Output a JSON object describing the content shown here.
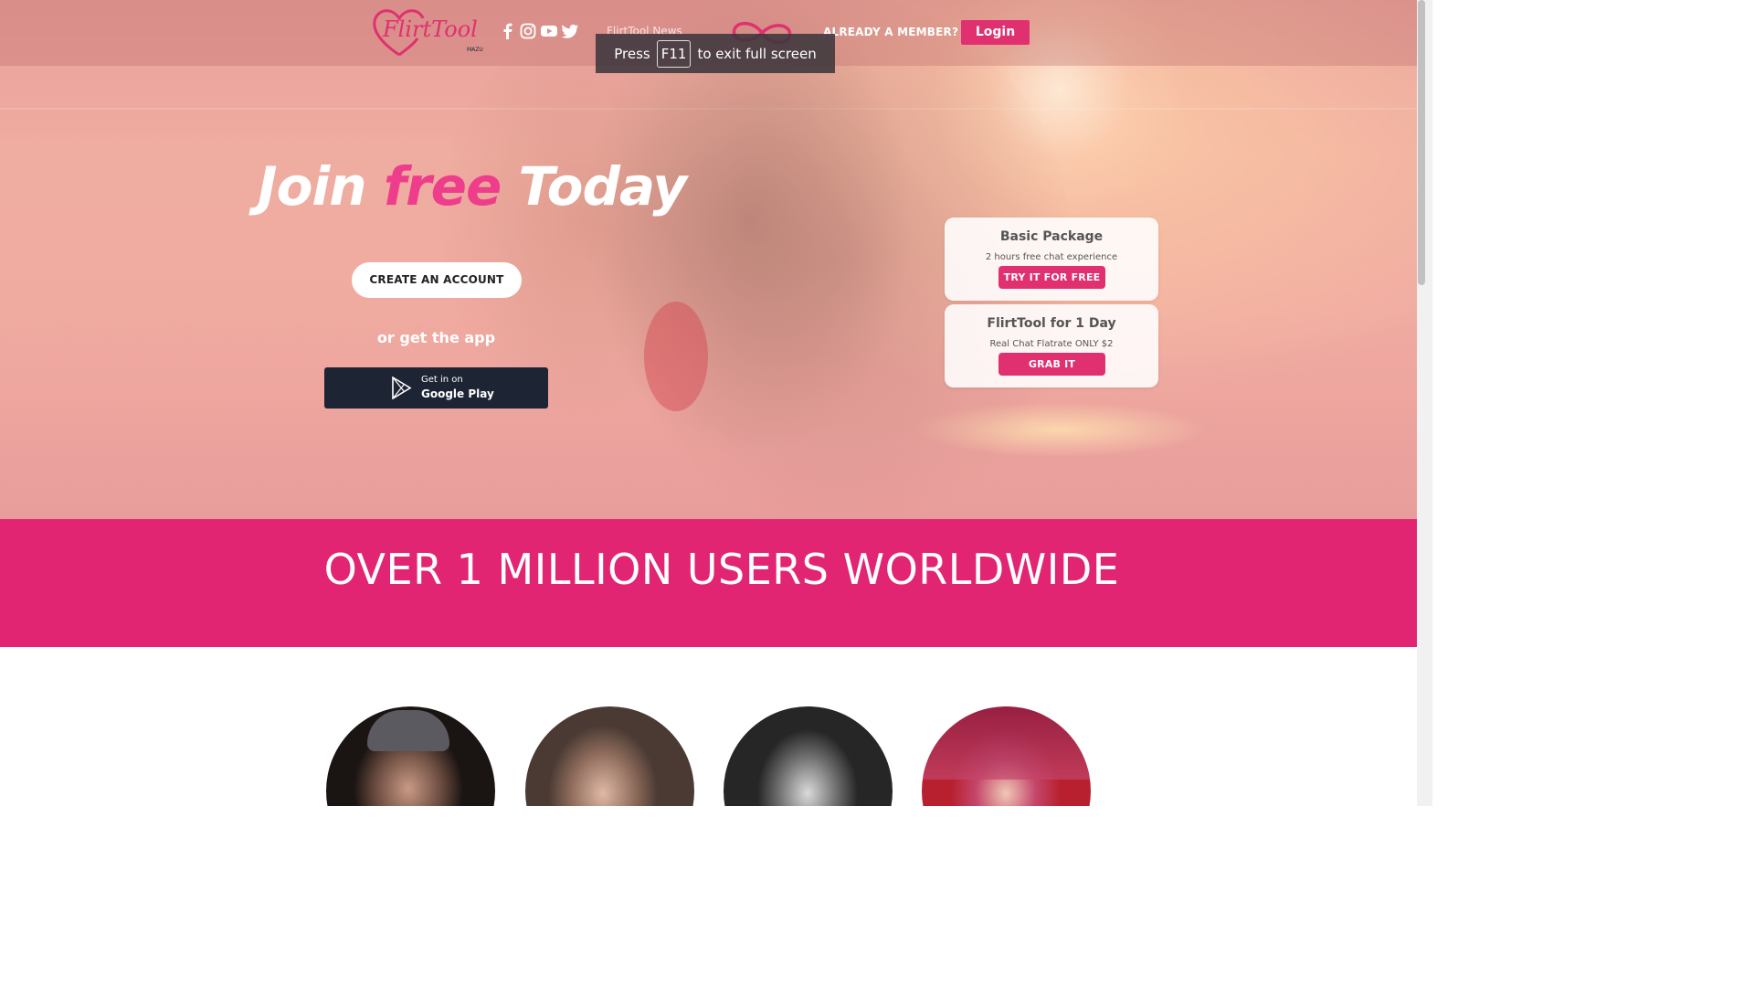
{
  "header": {
    "logo_text": "FlirtTool",
    "logo_badge": "MAZU",
    "social": [
      "facebook-icon",
      "instagram-icon",
      "youtube-icon",
      "twitter-icon"
    ],
    "news_link": "FlirtTool News",
    "already_member": "ALREADY A MEMBER?",
    "login_label": "Login"
  },
  "fullscreen_toast": {
    "press": "Press",
    "key": "F11",
    "suffix": "to exit full screen"
  },
  "hero": {
    "headline_join": "Join",
    "headline_free": "free",
    "headline_today": "Today",
    "create_account": "CREATE AN ACCOUNT",
    "or_get_app": "or get the app",
    "google_play_small": "Get in on",
    "google_play_big": "Google Play"
  },
  "packages": [
    {
      "title": "Basic Package",
      "subtitle": "2 hours free chat experience",
      "button": "TRY IT FOR FREE"
    },
    {
      "title": "FlirtTool for 1 Day",
      "subtitle": "Real Chat Flatrate ONLY $2",
      "button": "GRAB IT"
    }
  ],
  "banner": {
    "text": "OVER 1 MILLION USERS WORLDWIDE"
  },
  "colors": {
    "accent": "#e0306f",
    "banner": "#e12572",
    "free_text": "#ee3d8b",
    "google_play_bg": "#1d2433"
  }
}
